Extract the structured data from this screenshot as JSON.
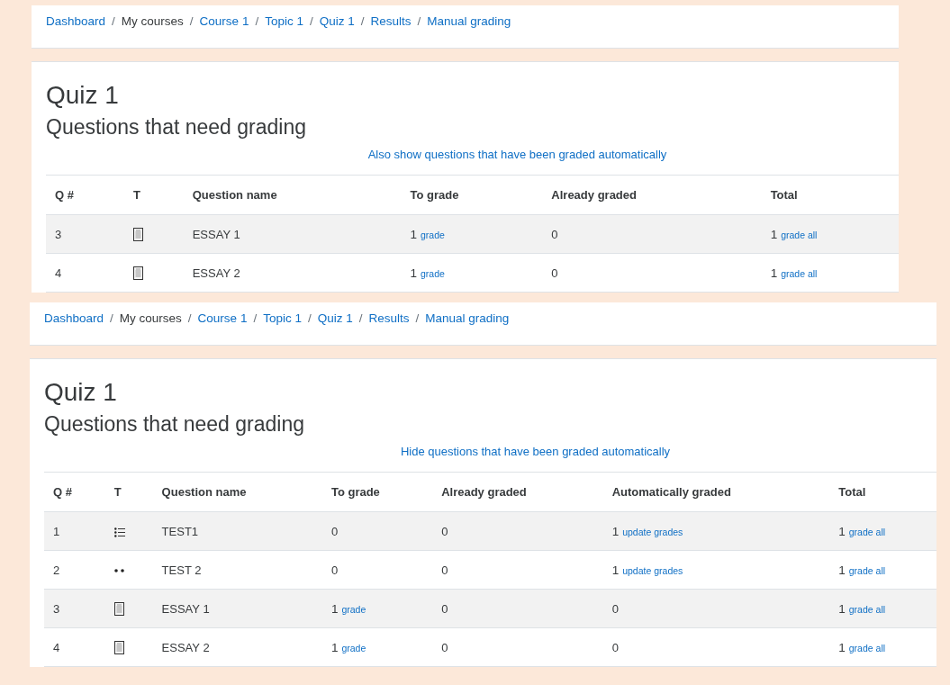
{
  "panels": [
    {
      "breadcrumb": [
        {
          "text": "Dashboard",
          "link": true
        },
        {
          "text": "My courses",
          "link": false
        },
        {
          "text": "Course 1",
          "link": true
        },
        {
          "text": "Topic 1",
          "link": true
        },
        {
          "text": "Quiz 1",
          "link": true
        },
        {
          "text": "Results",
          "link": true
        },
        {
          "text": "Manual grading",
          "link": true
        }
      ],
      "separator": "/",
      "title": "Quiz 1",
      "subtitle": "Questions that need grading",
      "toggle_link": "Also show questions that have been graded automatically",
      "columns": [
        "Q #",
        "T",
        "Question name",
        "To grade",
        "Already graded",
        "Total"
      ],
      "rows": [
        {
          "cells": [
            {
              "kind": "text",
              "text": "3"
            },
            {
              "kind": "essay"
            },
            {
              "kind": "text",
              "text": "ESSAY 1"
            },
            {
              "kind": "text",
              "text": "1",
              "link": "grade"
            },
            {
              "kind": "text",
              "text": "0"
            },
            {
              "kind": "text",
              "text": "1",
              "link": "grade all"
            }
          ]
        },
        {
          "cells": [
            {
              "kind": "text",
              "text": "4"
            },
            {
              "kind": "essay"
            },
            {
              "kind": "text",
              "text": "ESSAY 2"
            },
            {
              "kind": "text",
              "text": "1",
              "link": "grade"
            },
            {
              "kind": "text",
              "text": "0"
            },
            {
              "kind": "text",
              "text": "1",
              "link": "grade all"
            }
          ]
        }
      ]
    },
    {
      "breadcrumb": [
        {
          "text": "Dashboard",
          "link": true
        },
        {
          "text": "My courses",
          "link": false
        },
        {
          "text": "Course 1",
          "link": true
        },
        {
          "text": "Topic 1",
          "link": true
        },
        {
          "text": "Quiz 1",
          "link": true
        },
        {
          "text": "Results",
          "link": true
        },
        {
          "text": "Manual grading",
          "link": true
        }
      ],
      "separator": "/",
      "title": "Quiz 1",
      "subtitle": "Questions that need grading",
      "toggle_link": "Hide questions that have been graded automatically",
      "columns": [
        "Q #",
        "T",
        "Question name",
        "To grade",
        "Already graded",
        "Automatically graded",
        "Total"
      ],
      "rows": [
        {
          "cells": [
            {
              "kind": "text",
              "text": "1"
            },
            {
              "kind": "multichoice"
            },
            {
              "kind": "text",
              "text": "TEST1"
            },
            {
              "kind": "text",
              "text": "0"
            },
            {
              "kind": "text",
              "text": "0"
            },
            {
              "kind": "text",
              "text": "1",
              "link": "update grades"
            },
            {
              "kind": "text",
              "text": "1",
              "link": "grade all"
            }
          ]
        },
        {
          "cells": [
            {
              "kind": "text",
              "text": "2"
            },
            {
              "kind": "truefalse"
            },
            {
              "kind": "text",
              "text": "TEST 2"
            },
            {
              "kind": "text",
              "text": "0"
            },
            {
              "kind": "text",
              "text": "0"
            },
            {
              "kind": "text",
              "text": "1",
              "link": "update grades"
            },
            {
              "kind": "text",
              "text": "1",
              "link": "grade all"
            }
          ]
        },
        {
          "cells": [
            {
              "kind": "text",
              "text": "3"
            },
            {
              "kind": "essay"
            },
            {
              "kind": "text",
              "text": "ESSAY 1"
            },
            {
              "kind": "text",
              "text": "1",
              "link": "grade"
            },
            {
              "kind": "text",
              "text": "0"
            },
            {
              "kind": "text",
              "text": "0"
            },
            {
              "kind": "text",
              "text": "1",
              "link": "grade all"
            }
          ]
        },
        {
          "cells": [
            {
              "kind": "text",
              "text": "4"
            },
            {
              "kind": "essay"
            },
            {
              "kind": "text",
              "text": "ESSAY 2"
            },
            {
              "kind": "text",
              "text": "1",
              "link": "grade"
            },
            {
              "kind": "text",
              "text": "0"
            },
            {
              "kind": "text",
              "text": "0"
            },
            {
              "kind": "text",
              "text": "1",
              "link": "grade all"
            }
          ]
        }
      ]
    }
  ]
}
